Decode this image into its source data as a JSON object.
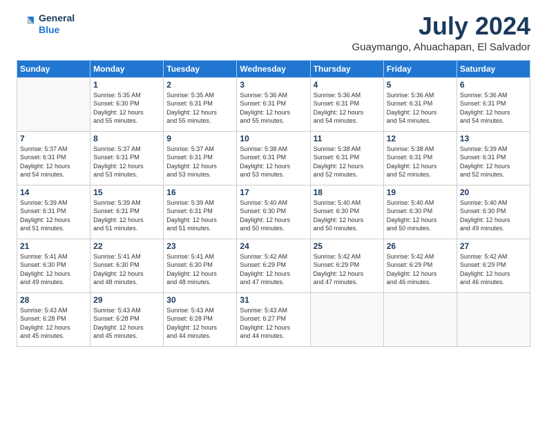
{
  "header": {
    "logo_line1": "General",
    "logo_line2": "Blue",
    "month": "July 2024",
    "location": "Guaymango, Ahuachapan, El Salvador"
  },
  "days_header": [
    "Sunday",
    "Monday",
    "Tuesday",
    "Wednesday",
    "Thursday",
    "Friday",
    "Saturday"
  ],
  "weeks": [
    [
      {
        "day": "",
        "content": ""
      },
      {
        "day": "1",
        "content": "Sunrise: 5:35 AM\nSunset: 6:30 PM\nDaylight: 12 hours\nand 55 minutes."
      },
      {
        "day": "2",
        "content": "Sunrise: 5:35 AM\nSunset: 6:31 PM\nDaylight: 12 hours\nand 55 minutes."
      },
      {
        "day": "3",
        "content": "Sunrise: 5:36 AM\nSunset: 6:31 PM\nDaylight: 12 hours\nand 55 minutes."
      },
      {
        "day": "4",
        "content": "Sunrise: 5:36 AM\nSunset: 6:31 PM\nDaylight: 12 hours\nand 54 minutes."
      },
      {
        "day": "5",
        "content": "Sunrise: 5:36 AM\nSunset: 6:31 PM\nDaylight: 12 hours\nand 54 minutes."
      },
      {
        "day": "6",
        "content": "Sunrise: 5:36 AM\nSunset: 6:31 PM\nDaylight: 12 hours\nand 54 minutes."
      }
    ],
    [
      {
        "day": "7",
        "content": "Sunrise: 5:37 AM\nSunset: 6:31 PM\nDaylight: 12 hours\nand 54 minutes."
      },
      {
        "day": "8",
        "content": "Sunrise: 5:37 AM\nSunset: 6:31 PM\nDaylight: 12 hours\nand 53 minutes."
      },
      {
        "day": "9",
        "content": "Sunrise: 5:37 AM\nSunset: 6:31 PM\nDaylight: 12 hours\nand 53 minutes."
      },
      {
        "day": "10",
        "content": "Sunrise: 5:38 AM\nSunset: 6:31 PM\nDaylight: 12 hours\nand 53 minutes."
      },
      {
        "day": "11",
        "content": "Sunrise: 5:38 AM\nSunset: 6:31 PM\nDaylight: 12 hours\nand 52 minutes."
      },
      {
        "day": "12",
        "content": "Sunrise: 5:38 AM\nSunset: 6:31 PM\nDaylight: 12 hours\nand 52 minutes."
      },
      {
        "day": "13",
        "content": "Sunrise: 5:39 AM\nSunset: 6:31 PM\nDaylight: 12 hours\nand 52 minutes."
      }
    ],
    [
      {
        "day": "14",
        "content": "Sunrise: 5:39 AM\nSunset: 6:31 PM\nDaylight: 12 hours\nand 51 minutes."
      },
      {
        "day": "15",
        "content": "Sunrise: 5:39 AM\nSunset: 6:31 PM\nDaylight: 12 hours\nand 51 minutes."
      },
      {
        "day": "16",
        "content": "Sunrise: 5:39 AM\nSunset: 6:31 PM\nDaylight: 12 hours\nand 51 minutes."
      },
      {
        "day": "17",
        "content": "Sunrise: 5:40 AM\nSunset: 6:30 PM\nDaylight: 12 hours\nand 50 minutes."
      },
      {
        "day": "18",
        "content": "Sunrise: 5:40 AM\nSunset: 6:30 PM\nDaylight: 12 hours\nand 50 minutes."
      },
      {
        "day": "19",
        "content": "Sunrise: 5:40 AM\nSunset: 6:30 PM\nDaylight: 12 hours\nand 50 minutes."
      },
      {
        "day": "20",
        "content": "Sunrise: 5:40 AM\nSunset: 6:30 PM\nDaylight: 12 hours\nand 49 minutes."
      }
    ],
    [
      {
        "day": "21",
        "content": "Sunrise: 5:41 AM\nSunset: 6:30 PM\nDaylight: 12 hours\nand 49 minutes."
      },
      {
        "day": "22",
        "content": "Sunrise: 5:41 AM\nSunset: 6:30 PM\nDaylight: 12 hours\nand 48 minutes."
      },
      {
        "day": "23",
        "content": "Sunrise: 5:41 AM\nSunset: 6:30 PM\nDaylight: 12 hours\nand 48 minutes."
      },
      {
        "day": "24",
        "content": "Sunrise: 5:42 AM\nSunset: 6:29 PM\nDaylight: 12 hours\nand 47 minutes."
      },
      {
        "day": "25",
        "content": "Sunrise: 5:42 AM\nSunset: 6:29 PM\nDaylight: 12 hours\nand 47 minutes."
      },
      {
        "day": "26",
        "content": "Sunrise: 5:42 AM\nSunset: 6:29 PM\nDaylight: 12 hours\nand 46 minutes."
      },
      {
        "day": "27",
        "content": "Sunrise: 5:42 AM\nSunset: 6:29 PM\nDaylight: 12 hours\nand 46 minutes."
      }
    ],
    [
      {
        "day": "28",
        "content": "Sunrise: 5:43 AM\nSunset: 6:28 PM\nDaylight: 12 hours\nand 45 minutes."
      },
      {
        "day": "29",
        "content": "Sunrise: 5:43 AM\nSunset: 6:28 PM\nDaylight: 12 hours\nand 45 minutes."
      },
      {
        "day": "30",
        "content": "Sunrise: 5:43 AM\nSunset: 6:28 PM\nDaylight: 12 hours\nand 44 minutes."
      },
      {
        "day": "31",
        "content": "Sunrise: 5:43 AM\nSunset: 6:27 PM\nDaylight: 12 hours\nand 44 minutes."
      },
      {
        "day": "",
        "content": ""
      },
      {
        "day": "",
        "content": ""
      },
      {
        "day": "",
        "content": ""
      }
    ]
  ]
}
